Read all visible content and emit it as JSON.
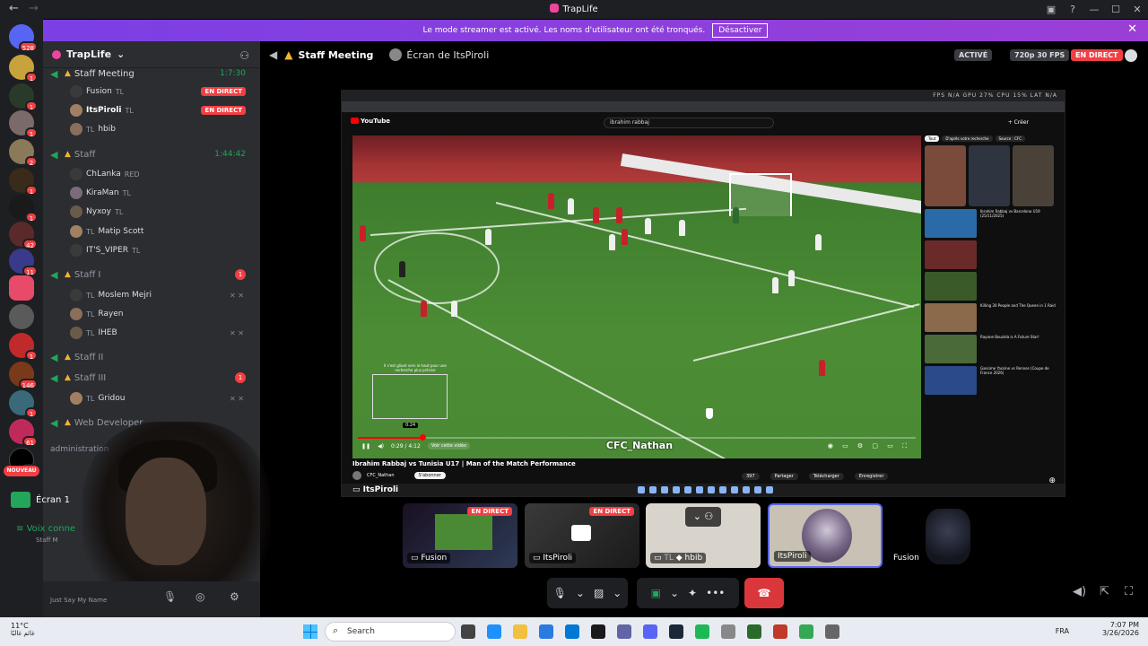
{
  "window": {
    "title": "TrapLife",
    "back": "←",
    "forward": "→"
  },
  "banner": {
    "text": "Le mode streamer est activé. Les noms d'utilisateur ont été tronqués.",
    "button": "Désactiver",
    "close": "✕"
  },
  "rail": {
    "top_badge": "528",
    "badges": [
      "1",
      "1",
      "1",
      "2",
      "1",
      "1",
      "42",
      "11",
      "1",
      "146",
      "1",
      "61",
      "97"
    ],
    "new_label": "NOUVEAU"
  },
  "server": {
    "name": "TrapLife"
  },
  "channels": [
    {
      "name": "Staff Meeting",
      "timer": "1:7:30"
    },
    {
      "name": "Staff",
      "timer": "1:44:42"
    },
    {
      "name": "Staff I",
      "badge": "1"
    },
    {
      "name": "Staff II"
    },
    {
      "name": "Staff III",
      "badge": "1"
    },
    {
      "name": "Web Developer"
    }
  ],
  "users": {
    "meeting": [
      {
        "name": "Fusion",
        "tag": "TL",
        "live": "EN DIRECT"
      },
      {
        "name": "ItsPiroli",
        "tag": "TL",
        "live": "EN DIRECT"
      },
      {
        "name": "hbib",
        "tag": "TL"
      }
    ],
    "staff": [
      {
        "name": "ChLanka",
        "tag": "RED"
      },
      {
        "name": "KiraMan",
        "tag": "TL"
      },
      {
        "name": "Nyxoy",
        "tag": "TL"
      },
      {
        "name": "Matip Scott",
        "tag": "TL"
      },
      {
        "name": "IT'S_VIPER",
        "tag": "TL"
      }
    ],
    "staff1": [
      {
        "name": "Moslem Mejri",
        "tag": "TL"
      },
      {
        "name": "Rayen",
        "tag": "TL"
      },
      {
        "name": "IHEB",
        "tag": "TL"
      }
    ],
    "staff3": [
      {
        "name": "Gridou",
        "tag": "TL"
      }
    ]
  },
  "category": "administration",
  "voice": {
    "screen": "Écran 1",
    "connected": "Voix conne",
    "sub": "Staff M",
    "user_status": "Just Say My Name"
  },
  "topbar": {
    "channel": "Staff Meeting",
    "screen_of": "Écran de ItsPiroli",
    "chip_active": "ACTIVÉ",
    "chip_quality": "720p 30 FPS",
    "chip_live": "EN DIRECT"
  },
  "stream": {
    "perf": "FPS N/A   GPU 27%   CPU 15%   LAT N/A",
    "search": "ibrahim rabbaj",
    "create": "+ Créer",
    "time": "0:29 / 4:12",
    "chapter": "Voir cette vidéo",
    "watermark": "CFC_Nathan",
    "video_title": "Ibrahim Rabbaj vs Tunisia U17 | Man of the Match Performance",
    "channel_name": "CFC_Nathan",
    "subscribe": "S'abonner",
    "actions": [
      "397",
      "Partager",
      "Télécharger",
      "Enregistrer"
    ],
    "chips": [
      "Tout",
      "D'après votre recherche",
      "Source : CFC"
    ],
    "recs": [
      "Ibrahim Rabbaj vs Barcelona U19 (25/11/2025)",
      "Killing 30 People and The Queen in 1 Raid",
      "Rayane Bouzida is A Future Star!",
      "Gassime Yassine vs Rennes (Coupe de France 2026)"
    ],
    "streamer_name": "ItsPiroli",
    "preview_time": "0:24",
    "preview_caption": "Il s'est glissé vers le haut pour une recherche plus précise"
  },
  "tiles": [
    {
      "name": "Fusion",
      "live": "EN DIRECT"
    },
    {
      "name": "ItsPiroli",
      "live": "EN DIRECT"
    },
    {
      "name": "hbib",
      "tag": "TL"
    },
    {
      "name": "ItsPiroli"
    },
    {
      "name": "Fusion"
    }
  ],
  "taskbar": {
    "temp": "11°C",
    "weather": "غائم غالبًا",
    "search": "Search",
    "lang": "FRA",
    "time": "7:07 PM",
    "date": "3/26/2026"
  },
  "colors": {
    "accent": "#5865f2",
    "live": "#f23f43",
    "voice_green": "#23a55a",
    "banner": "#8a3fdc"
  }
}
